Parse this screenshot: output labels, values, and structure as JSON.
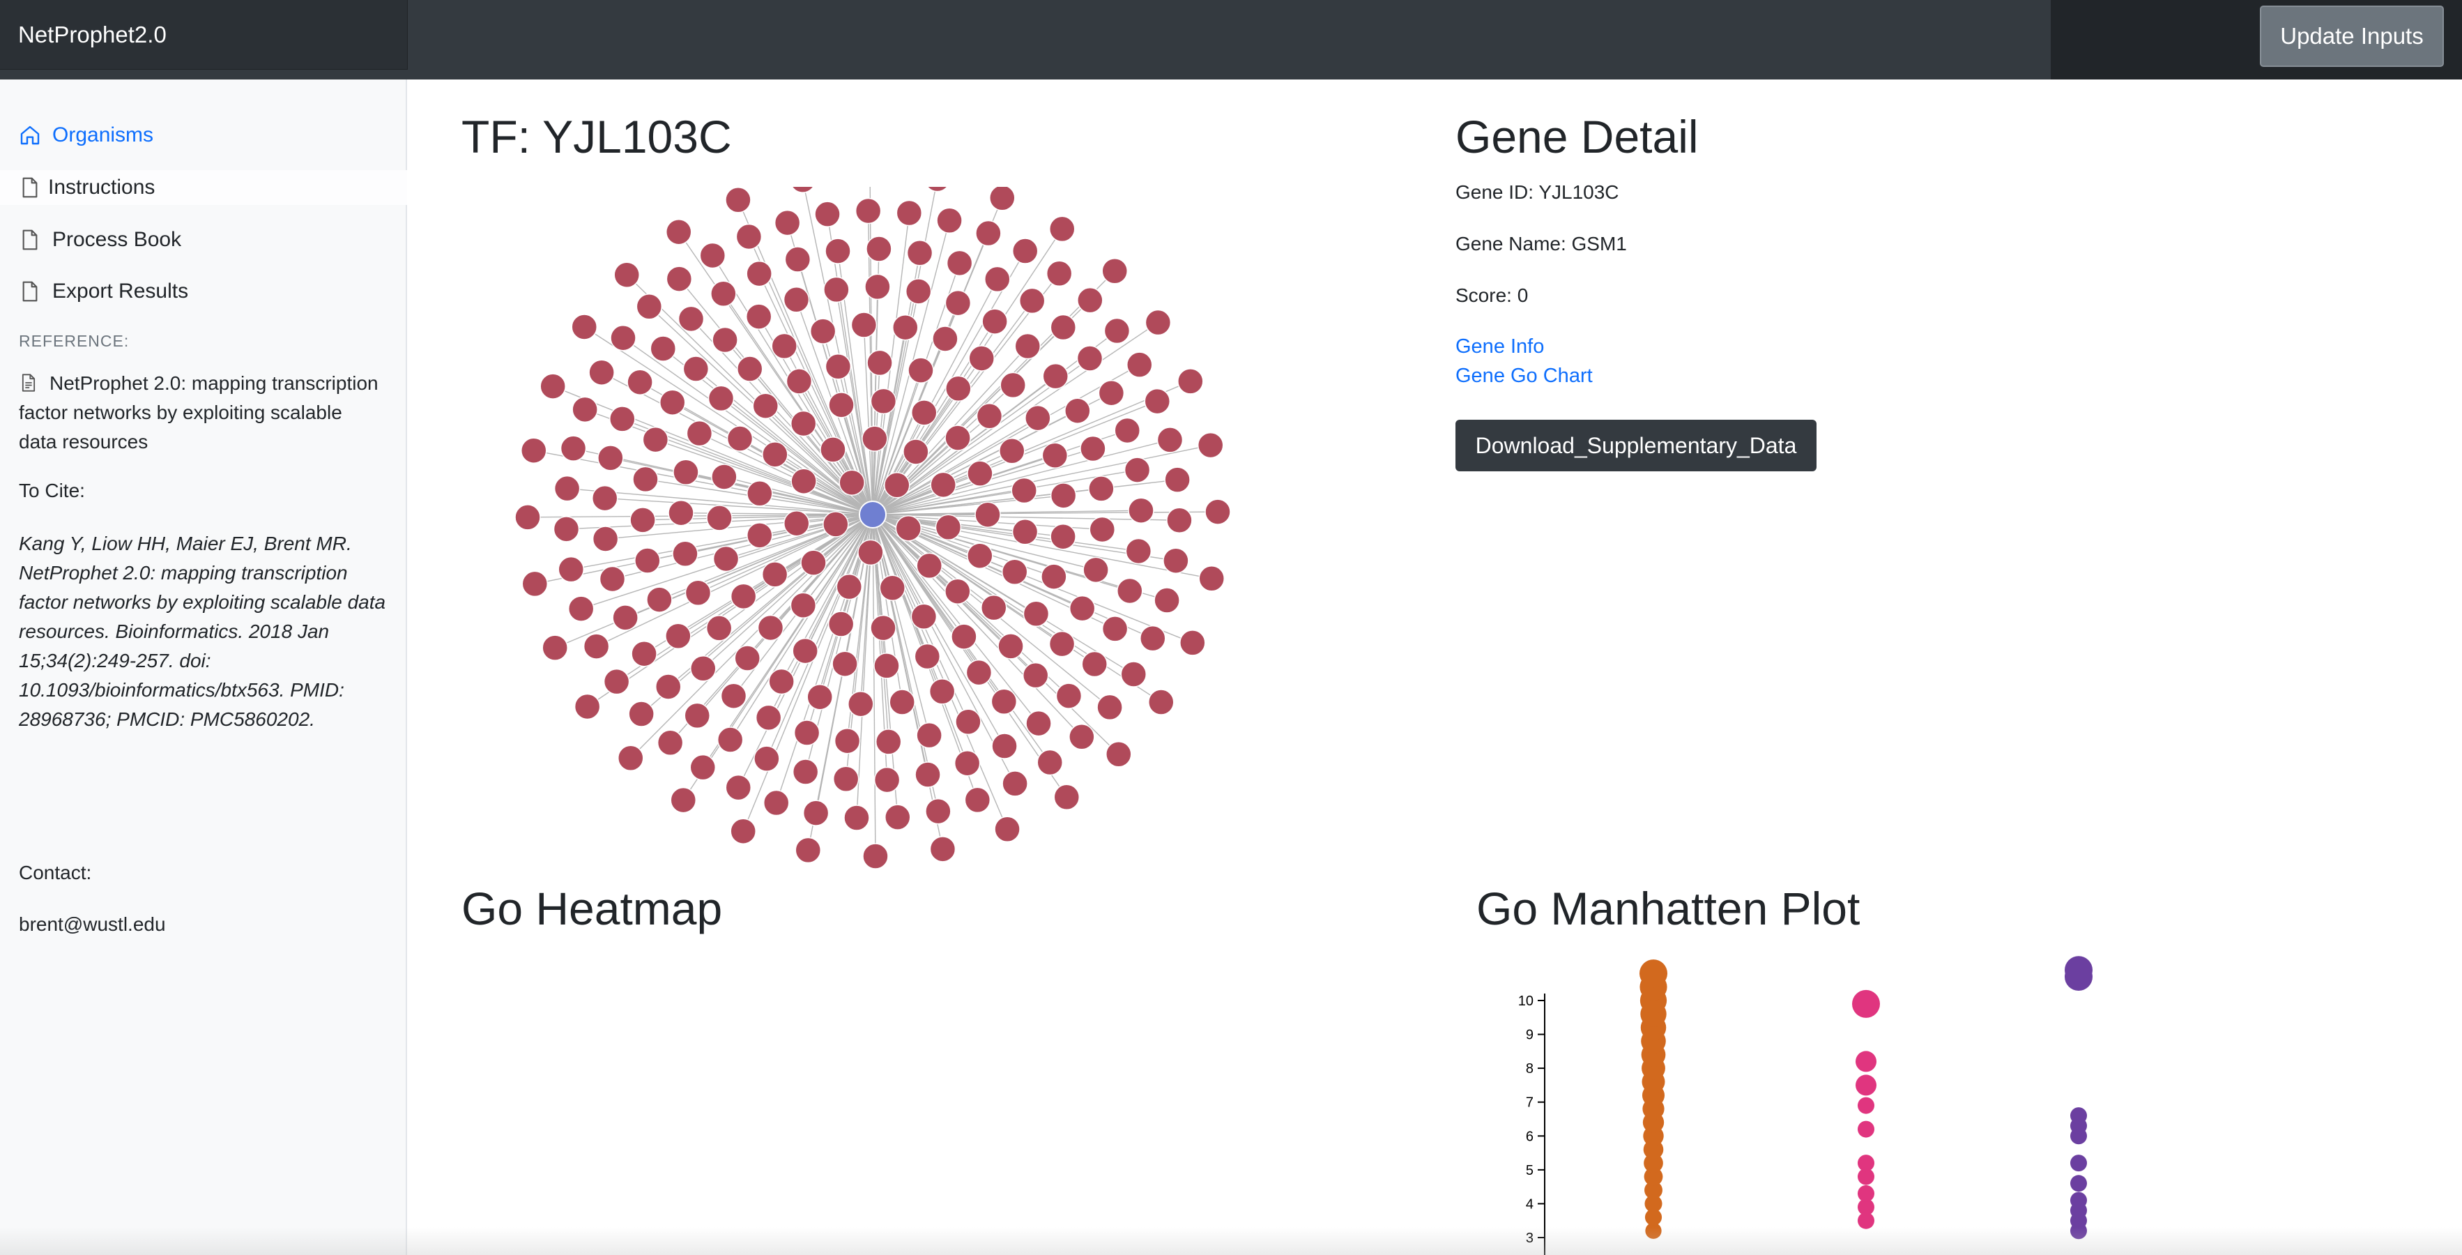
{
  "navbar": {
    "brand": "NetProphet2.0",
    "update_button": "Update Inputs"
  },
  "sidebar": {
    "items": [
      {
        "label": "Organisms",
        "icon": "home-icon",
        "active": true
      },
      {
        "label": "Instructions",
        "icon": "file-icon"
      },
      {
        "label": "Process Book",
        "icon": "file-icon"
      },
      {
        "label": "Export Results",
        "icon": "file-icon"
      }
    ],
    "reference_heading": "REFERENCE:",
    "reference_text": "NetProphet 2.0: mapping transcription factor networks by exploiting scalable data resources",
    "cite_label": "To Cite:",
    "citation": "Kang Y, Liow HH, Maier EJ, Brent MR. NetProphet 2.0: mapping transcription factor networks by exploiting scalable data resources. Bioinformatics. 2018 Jan 15;34(2):249-257. doi: 10.1093/bioinformatics/btx563. PMID: 28968736; PMCID: PMC5860202.",
    "contact_label": "Contact:",
    "contact_email": "brent@wustl.edu"
  },
  "network": {
    "title": "TF: YJL103C",
    "center_color": "#6f7fd1",
    "node_color": "#b04a5a",
    "edge_color": "#b5b5b5",
    "target_node_count": 240
  },
  "gene_detail": {
    "title": "Gene Detail",
    "gene_id": "Gene ID: YJL103C",
    "gene_name": "Gene Name: GSM1",
    "score": "Score: 0",
    "links": [
      "Gene Info",
      "Gene Go Chart"
    ],
    "download_button": "Download_Supplementary_Data"
  },
  "heatmap": {
    "title": "Go Heatmap"
  },
  "manhattan": {
    "title": "Go Manhatten Plot",
    "chart_data": {
      "type": "scatter",
      "title": "Go Manhatten Plot",
      "y_ticks": [
        "3",
        "4",
        "5",
        "6",
        "7",
        "8",
        "9",
        "10"
      ],
      "ylim": [
        3,
        10
      ],
      "series": [
        {
          "color": "#d2691e",
          "points": [
            3.2,
            3.6,
            4.0,
            4.4,
            4.8,
            5.2,
            5.6,
            6.0,
            6.4,
            6.8,
            7.2,
            7.6,
            8.0,
            8.4,
            8.8,
            9.2,
            9.6,
            10.0,
            10.4,
            10.8
          ]
        },
        {
          "color": "#e0357f",
          "points": [
            3.5,
            3.9,
            4.3,
            4.8,
            5.2,
            6.2,
            6.9,
            7.5,
            8.2,
            9.9
          ]
        },
        {
          "color": "#6b3fa0",
          "points": [
            3.2,
            3.5,
            3.8,
            4.1,
            4.6,
            5.2,
            6.0,
            6.3,
            6.6,
            10.7,
            10.9
          ]
        }
      ]
    }
  }
}
